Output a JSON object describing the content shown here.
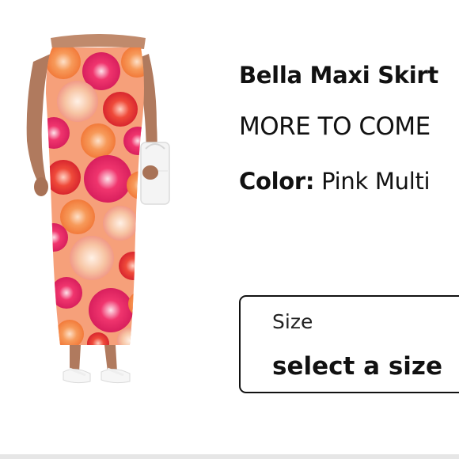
{
  "product": {
    "image_alt": "Model wearing floral maxi skirt",
    "title": "Bella Maxi Skirt",
    "brand": "MORE TO COME",
    "color_label": "Color:",
    "color_value": "Pink Multi"
  },
  "size_selector": {
    "label": "Size",
    "value": "select a size"
  },
  "colors": {
    "text": "#111111",
    "skirt_primary": "#f0356e",
    "skirt_orange": "#f79a5a",
    "skirt_peach": "#f7c5a4"
  }
}
